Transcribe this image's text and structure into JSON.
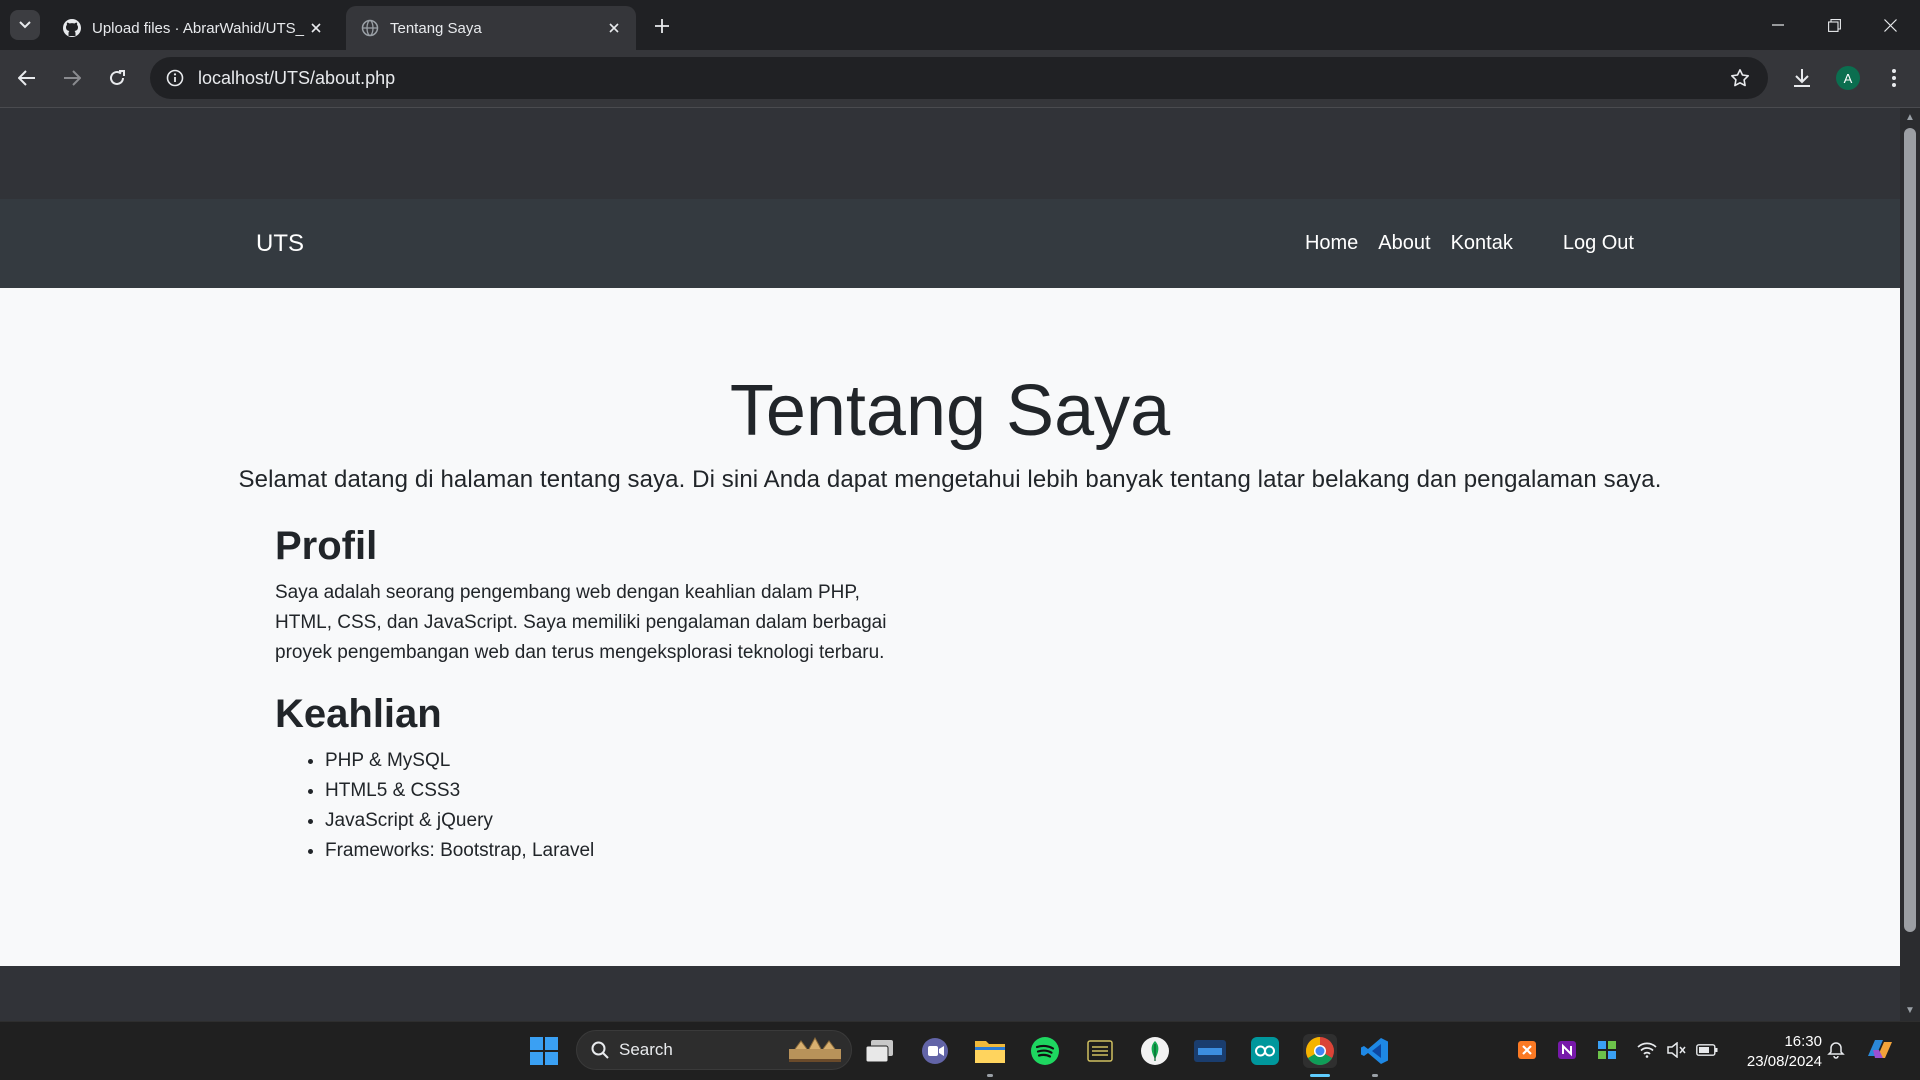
{
  "browser": {
    "tabs": [
      {
        "title": "Upload files · AbrarWahid/UTS_",
        "icon": "github-icon",
        "active": false
      },
      {
        "title": "Tentang Saya",
        "icon": "globe-icon",
        "active": true
      }
    ],
    "url": "localhost/UTS/about.php",
    "profile_initial": "A"
  },
  "page": {
    "navbar": {
      "brand": "UTS",
      "links": [
        "Home",
        "About",
        "Kontak"
      ],
      "logout": "Log Out"
    },
    "title": "Tentang Saya",
    "lead": "Selamat datang di halaman tentang saya. Di sini Anda dapat mengetahui lebih banyak tentang latar belakang dan pengalaman saya.",
    "profile": {
      "heading": "Profil",
      "lines": [
        "Saya adalah seorang pengembang web dengan keahlian dalam PHP,",
        "HTML, CSS, dan JavaScript. Saya memiliki pengalaman dalam berbagai",
        "proyek pengembangan web dan terus mengeksplorasi teknologi terbaru."
      ]
    },
    "skills": {
      "heading": "Keahlian",
      "items": [
        "PHP & MySQL",
        "HTML5 & CSS3",
        "JavaScript & jQuery",
        "Frameworks: Bootstrap, Laravel"
      ]
    }
  },
  "taskbar": {
    "search_label": "Search",
    "time": "16:30",
    "date": "23/08/2024"
  },
  "colors": {
    "navbar": "#343a40",
    "content_bg": "#f8f9fa",
    "text": "#212529",
    "chrome_bg": "#202124",
    "chrome_toolbar": "#35363a"
  }
}
